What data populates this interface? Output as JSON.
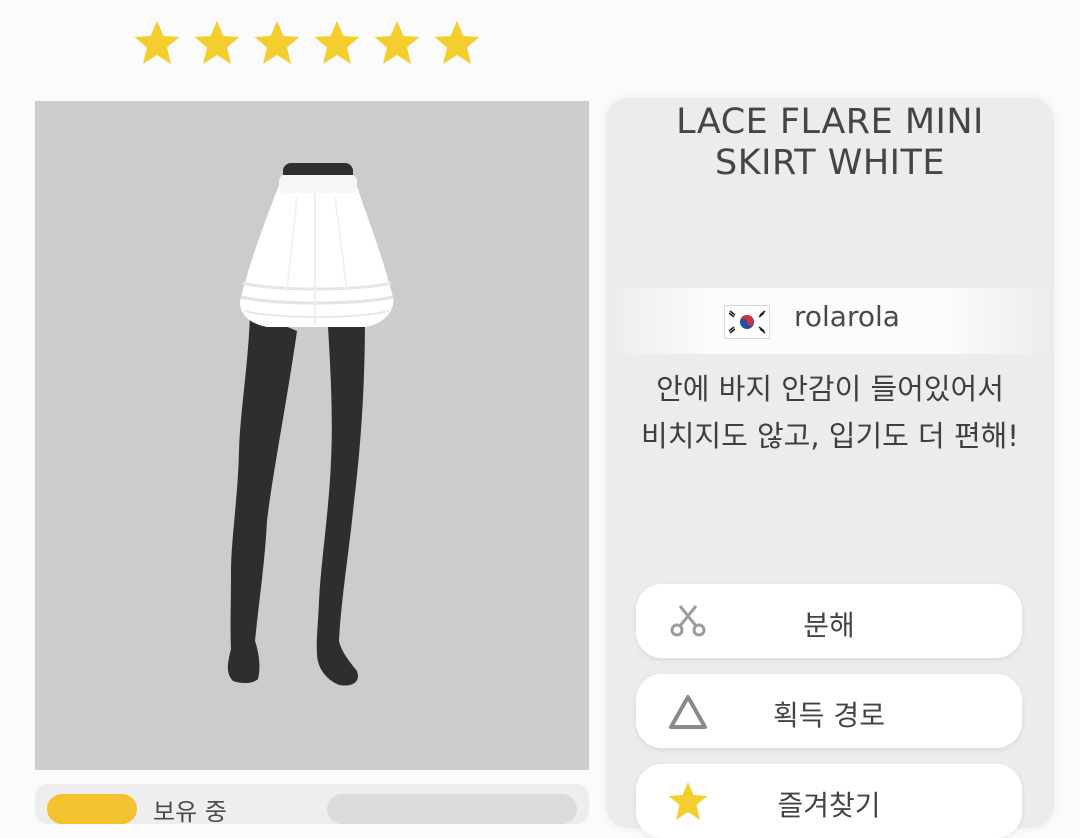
{
  "rating": {
    "stars": 6,
    "star_color": "#f3ce2e"
  },
  "item": {
    "title_line1": "LACE FLARE MINI",
    "title_line2": "SKIRT WHITE",
    "creator": "rolarola",
    "creator_flag": "south-korea-flag",
    "description_line1": "안에 바지 안감이 들어있어서",
    "description_line2": "비치지도 않고, 입기도 더 편해!"
  },
  "preview": {
    "background": "#cccccc",
    "skirt_color": "#ffffff",
    "mannequin_color": "#2e2e2e"
  },
  "actions": [
    {
      "label": "분해",
      "icon": "scissors-icon"
    },
    {
      "label": "획득 경로",
      "icon": "triangle-icon"
    },
    {
      "label": "즐겨찾기",
      "icon": "star-icon"
    }
  ],
  "bottom_bar": {
    "owned_label": "보유 중"
  }
}
